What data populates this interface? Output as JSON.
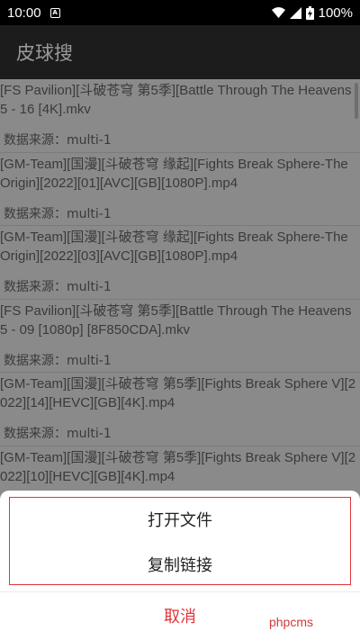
{
  "status_bar": {
    "time": "10:00",
    "notification_icon": "A",
    "battery_percent": "100%"
  },
  "app_bar": {
    "title": "皮球搜"
  },
  "list": {
    "items": [
      {
        "title": "[FS Pavilion][斗破苍穹 第5季][Battle Through The Heavens 5 - 16 [4K].mkv",
        "source": "数据来源：multi-1"
      },
      {
        "title": "[GM-Team][国漫][斗破苍穹 缘起][Fights Break Sphere-The Origin][2022][01][AVC][GB][1080P].mp4",
        "source": "数据来源：multi-1"
      },
      {
        "title": "[GM-Team][国漫][斗破苍穹 缘起][Fights Break Sphere-The Origin][2022][03][AVC][GB][1080P].mp4",
        "source": "数据来源：multi-1"
      },
      {
        "title": "[FS Pavilion][斗破苍穹 第5季][Battle Through The Heavens 5 - 09 [1080p] [8F850CDA].mkv",
        "source": "数据来源：multi-1"
      },
      {
        "title": "[GM-Team][国漫][斗破苍穹 第5季][Fights Break Sphere V][2022][14][HEVC][GB][4K].mp4",
        "source": "数据来源：multi-1"
      },
      {
        "title": "[GM-Team][国漫][斗破苍穹 第5季][Fights Break Sphere V][2022][10][HEVC][GB][4K].mp4",
        "source": ""
      }
    ]
  },
  "sheet": {
    "open_file": "打开文件",
    "copy_link": "复制链接",
    "cancel": "取消"
  },
  "watermark": "phpcms",
  "colors": {
    "accent": "#e0343a",
    "app_bar": "#1c1c1c",
    "scrim": "#8a8a8a"
  }
}
